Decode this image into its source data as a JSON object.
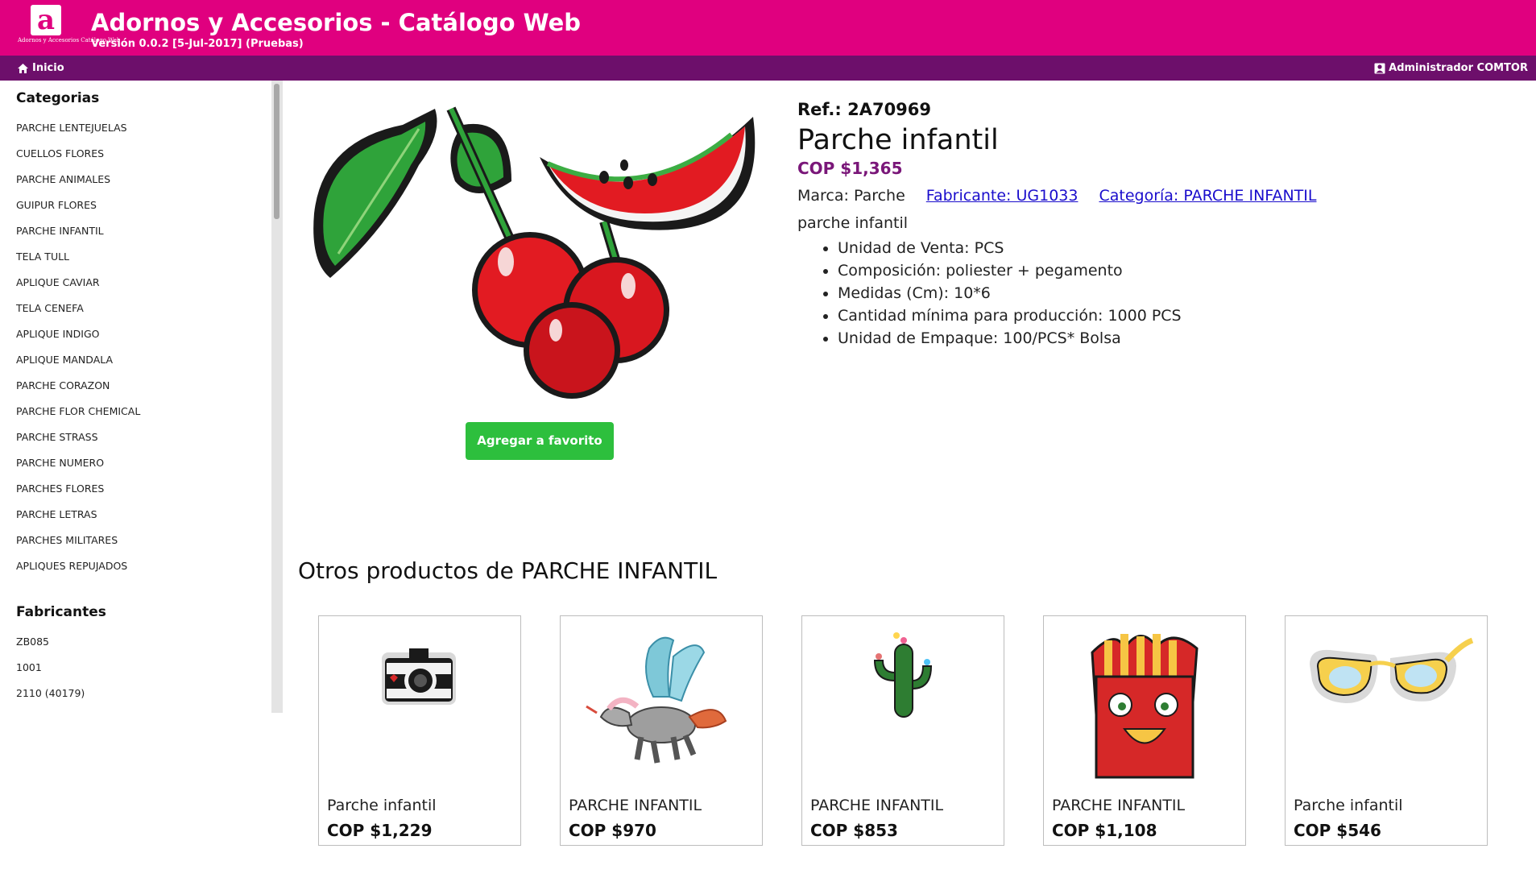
{
  "header": {
    "logo_letter": "a",
    "logo_caption": "Adornos y Accesorios Catálogo Web",
    "title": "Adornos y Accesorios - Catálogo Web",
    "version": "Versión 0.0.2 [5-Jul-2017] (Pruebas)"
  },
  "nav": {
    "home_label": "Inicio",
    "user_label": "Administrador COMTOR"
  },
  "sidebar": {
    "categories_title": "Categorias",
    "categories": [
      "PARCHE LENTEJUELAS",
      "CUELLOS FLORES",
      "PARCHE ANIMALES",
      "GUIPUR FLORES",
      "PARCHE INFANTIL",
      "TELA TULL",
      "APLIQUE CAVIAR",
      "TELA CENEFA",
      "APLIQUE INDIGO",
      "APLIQUE MANDALA",
      "PARCHE CORAZON",
      "PARCHE FLOR CHEMICAL",
      "PARCHE STRASS",
      "PARCHE NUMERO",
      "PARCHES FLORES",
      "PARCHE LETRAS",
      "PARCHES MILITARES",
      "APLIQUES REPUJADOS"
    ],
    "manufacturers_title": "Fabricantes",
    "manufacturers": [
      "ZB085",
      "1001",
      "2110 (40179)"
    ]
  },
  "product": {
    "ref": "Ref.: 2A70969",
    "name": "Parche infantil",
    "price": "COP $1,365",
    "brand": "Marca: Parche",
    "manufacturer_link": "Fabricante: UG1033",
    "category_link": "Categoría: PARCHE INFANTIL",
    "description": "parche infantil",
    "specs": [
      "Unidad de Venta: PCS",
      "Composición: poliester + pegamento",
      "Medidas (Cm): 10*6",
      "Cantidad mínima para producción: 1000 PCS",
      "Unidad de Empaque: 100/PCS* Bolsa"
    ],
    "image_icon": "cherry-watermelon-patch-image",
    "favorite_button": "Agregar a favorito"
  },
  "related": {
    "title": "Otros productos de PARCHE INFANTIL",
    "items": [
      {
        "name": "Parche infantil",
        "price": "COP $1,229",
        "icon": "camera-patch-image"
      },
      {
        "name": "PARCHE INFANTIL",
        "price": "COP $970",
        "icon": "pegasus-patch-image"
      },
      {
        "name": "PARCHE INFANTIL",
        "price": "COP $853",
        "icon": "cactus-patch-image"
      },
      {
        "name": "PARCHE INFANTIL",
        "price": "COP $1,108",
        "icon": "fries-patch-image"
      },
      {
        "name": "Parche infantil",
        "price": "COP $546",
        "icon": "glasses-patch-image"
      }
    ]
  },
  "colors": {
    "header_bg": "#e0007f",
    "nav_bg": "#6d0f6b",
    "price": "#7a1779",
    "button": "#2dbf3d",
    "link": "#1a0dcc"
  }
}
